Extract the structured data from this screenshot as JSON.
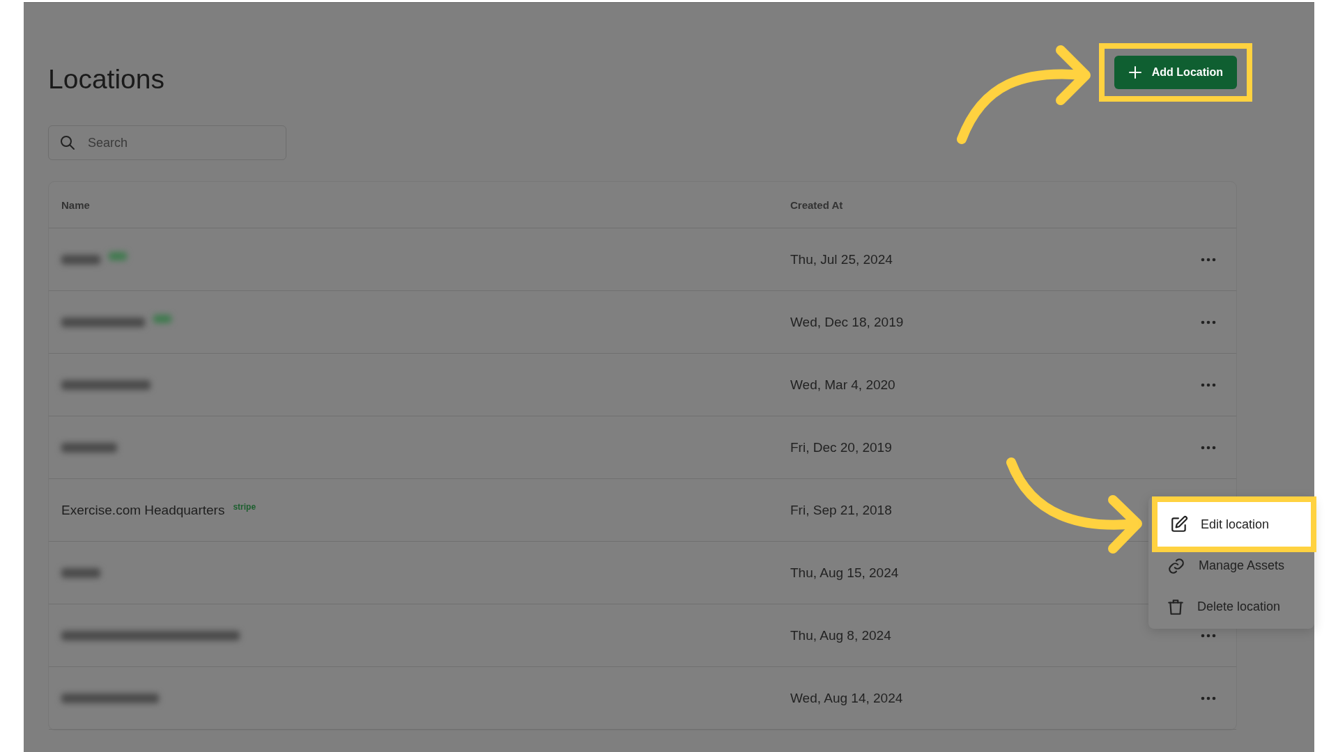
{
  "page": {
    "title": "Locations"
  },
  "add_button": {
    "label": "Add Location",
    "highlighted": true
  },
  "search": {
    "placeholder": "Search"
  },
  "table": {
    "columns": [
      "Name",
      "Created At"
    ],
    "rows": [
      {
        "kind": "blurred",
        "badge": true,
        "created_at": "Thu, Jul 25, 2024",
        "actions_visible": true
      },
      {
        "kind": "blurred",
        "badge": true,
        "created_at": "Wed, Dec 18, 2019",
        "actions_visible": true
      },
      {
        "kind": "blurred",
        "badge": false,
        "created_at": "Wed, Mar 4, 2020",
        "actions_visible": true
      },
      {
        "kind": "blurred",
        "badge": false,
        "created_at": "Fri, Dec 20, 2019",
        "actions_visible": true
      },
      {
        "kind": "text",
        "name": "Exercise.com Headquarters",
        "badge_label": "stripe",
        "created_at": "Fri, Sep 21, 2018"
      },
      {
        "kind": "blurred",
        "badge": false,
        "created_at": "Thu, Aug 15, 2024"
      },
      {
        "kind": "blurred",
        "badge": false,
        "created_at": "Thu, Aug 8, 2024",
        "actions_visible": true
      },
      {
        "kind": "blurred",
        "badge": false,
        "created_at": "Wed, Aug 14, 2024",
        "actions_visible": true
      }
    ]
  },
  "menu": {
    "items": [
      {
        "kind": "edit",
        "label": "Edit location",
        "highlighted": true
      },
      {
        "kind": "link",
        "label": "Manage Assets",
        "highlighted": false
      },
      {
        "kind": "trash",
        "label": "Delete location",
        "highlighted": false
      }
    ]
  }
}
